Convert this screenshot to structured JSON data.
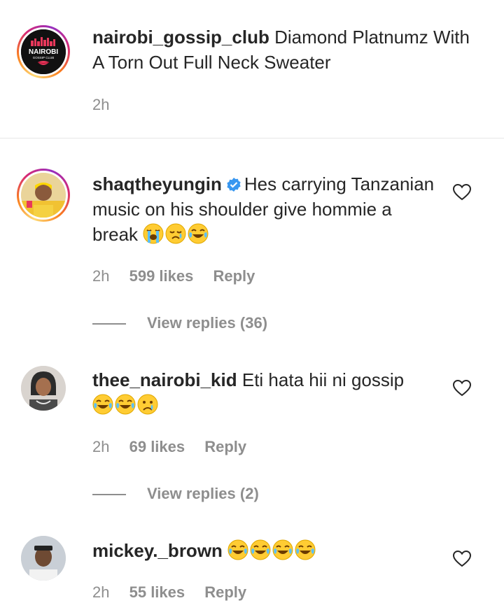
{
  "caption": {
    "username": "nairobi_gossip_club",
    "text": "Diamond Platnumz With A Torn Out Full Neck Sweater",
    "time": "2h",
    "avatar_logo_text": "NAIROBI",
    "avatar_logo_sub": "GOSSIP CLUB"
  },
  "comments": [
    {
      "username": "shaqtheyungin",
      "verified": true,
      "text": "Hes carrying Tanzanian music on his shoulder give hommie a break",
      "emojis": [
        "loudly-crying-face",
        "sad-face",
        "tears-of-joy"
      ],
      "time": "2h",
      "likes": "599 likes",
      "reply": "Reply",
      "view_replies": "View replies (36)"
    },
    {
      "username": "thee_nairobi_kid",
      "verified": false,
      "text": "Eti hata hii ni gossip",
      "emojis": [
        "tears-of-joy",
        "tears-of-joy",
        "crying-face"
      ],
      "time": "2h",
      "likes": "69 likes",
      "reply": "Reply",
      "view_replies": "View replies (2)"
    },
    {
      "username": "mickey._brown",
      "verified": false,
      "text": "",
      "emojis": [
        "tears-of-joy",
        "tears-of-joy",
        "tears-of-joy",
        "tears-of-joy"
      ],
      "time": "2h",
      "likes": "55 likes",
      "reply": "Reply"
    }
  ],
  "colors": {
    "text": "#262626",
    "secondary": "#8e8e8e",
    "verified": "#3897f0",
    "divider": "#e6e6e6"
  }
}
